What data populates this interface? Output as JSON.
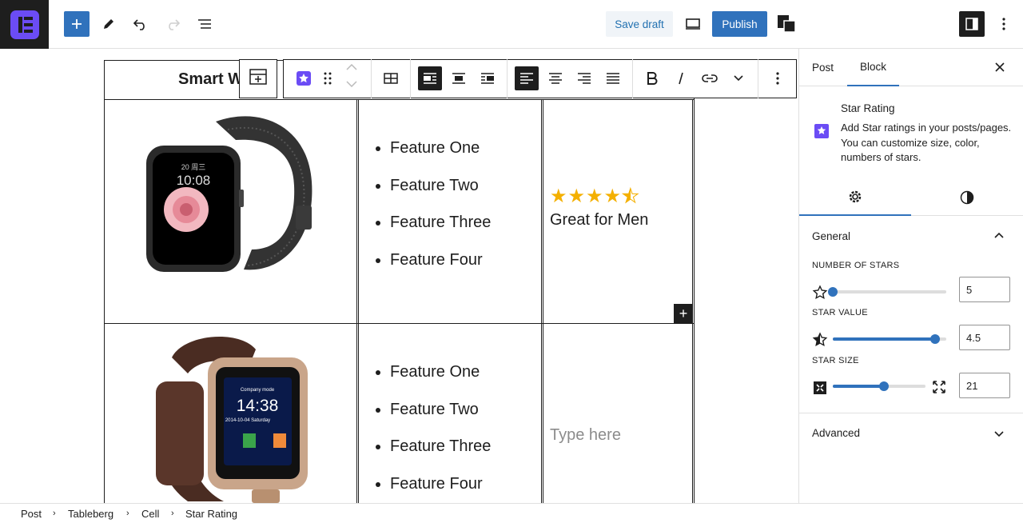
{
  "topbar": {
    "logo_icon": "site-logo-icon",
    "inserter_icon": "plus-icon",
    "tools_icon": "pencil-icon",
    "undo_icon": "undo-icon",
    "redo_icon": "redo-icon",
    "outline_icon": "list-view-icon",
    "save_draft_label": "Save draft",
    "preview_icon": "desktop-preview-icon",
    "publish_label": "Publish",
    "plugin_icon": "plugin-icon",
    "settings_icon": "sidebar-toggle-icon",
    "more_icon": "more-vertical-icon",
    "accent": "#3072bc"
  },
  "table": {
    "title_partial": "Smart W",
    "rows": [
      {
        "image": "smartwatch-black-mesh",
        "features": [
          "Feature One",
          "Feature Two",
          "Feature Three",
          "Feature Four"
        ],
        "rating": {
          "value": 4.5,
          "out_of": 5,
          "color": "#f4b000"
        },
        "rating_text": "Great for Men"
      },
      {
        "image": "smartwatch-gold-brown",
        "features": [
          "Feature One",
          "Feature Two",
          "Feature Three",
          "Feature Four"
        ],
        "placeholder": "Type here"
      }
    ]
  },
  "block_toolbar": {
    "icons": [
      "add-row-icon",
      "star-rating-block-icon",
      "drag-handle-icon",
      "move-up-icon",
      "move-down-icon",
      "table-icon",
      "align-left-wrap-icon",
      "align-center-block-icon",
      "align-right-wrap-icon",
      "text-align-left-icon",
      "text-align-center-icon",
      "text-align-right-icon",
      "text-justify-icon",
      "bold-icon",
      "italic-icon",
      "link-icon",
      "chevron-down-icon",
      "more-options-icon"
    ]
  },
  "sidebar": {
    "tabs": [
      "Post",
      "Block"
    ],
    "active_tab": "Block",
    "block": {
      "title": "Star Rating",
      "description": "Add Star ratings in your posts/pages. You can customize size, color, numbers of stars."
    },
    "general": {
      "title": "General",
      "number_of_stars_label": "NUMBER OF STARS",
      "number_of_stars": "5",
      "number_of_stars_fraction": 0.0,
      "star_value_label": "STAR VALUE",
      "star_value": "4.5",
      "star_value_fraction": 0.9,
      "star_size_label": "STAR SIZE",
      "star_size": "21",
      "star_size_fraction": 0.55
    },
    "advanced": {
      "title": "Advanced"
    }
  },
  "breadcrumb": [
    "Post",
    "Tableberg",
    "Cell",
    "Star Rating"
  ]
}
